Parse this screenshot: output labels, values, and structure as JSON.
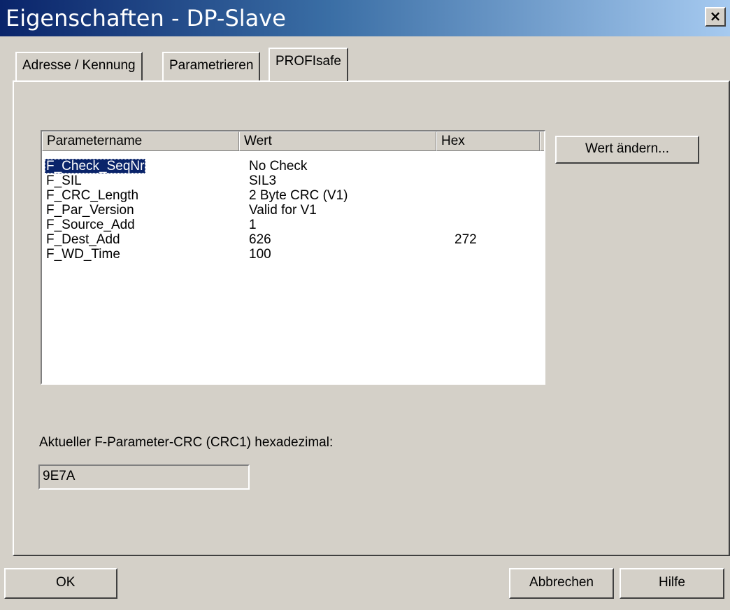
{
  "window": {
    "title": "Eigenschaften - DP-Slave",
    "close_symbol": "×"
  },
  "tabs": [
    {
      "label": "Adresse / Kennung",
      "active": false
    },
    {
      "label": "Parametrieren",
      "active": false
    },
    {
      "label": "PROFIsafe",
      "active": true
    }
  ],
  "parameter_table": {
    "columns": [
      "Parametername",
      "Wert",
      "Hex"
    ],
    "rows": [
      {
        "name": "F_Check_SeqNr",
        "value": "No Check",
        "hex": "",
        "selected": true
      },
      {
        "name": "F_SIL",
        "value": "SIL3",
        "hex": ""
      },
      {
        "name": "F_CRC_Length",
        "value": "2 Byte CRC (V1)",
        "hex": ""
      },
      {
        "name": "F_Par_Version",
        "value": "Valid for V1",
        "hex": ""
      },
      {
        "name": "F_Source_Add",
        "value": "1",
        "hex": ""
      },
      {
        "name": "F_Dest_Add",
        "value": "626",
        "hex": "272"
      },
      {
        "name": "F_WD_Time",
        "value": "100",
        "hex": ""
      }
    ]
  },
  "change_value_button": "Wert ändern...",
  "crc": {
    "label": "Aktueller F-Parameter-CRC (CRC1) hexadezimal:",
    "value": "9E7A"
  },
  "footer": {
    "ok": "OK",
    "cancel": "Abbrechen",
    "help": "Hilfe"
  }
}
